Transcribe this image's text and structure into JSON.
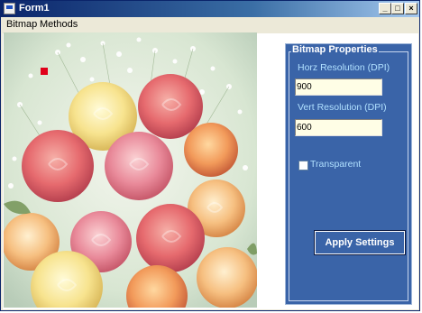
{
  "window": {
    "title": "Form1",
    "icon": "form-icon"
  },
  "title_buttons": {
    "minimize": "_",
    "maximize": "□",
    "close": "×"
  },
  "menu": {
    "items": [
      {
        "label": "Bitmap"
      },
      {
        "label": "Methods"
      }
    ]
  },
  "picture": {
    "description_icon": "roses-bouquet-image"
  },
  "properties": {
    "group_title": "Bitmap Properties",
    "horz_label": "Horz Resolution (DPI)",
    "horz_value": "900",
    "vert_label": "Vert Resolution (DPI)",
    "vert_value": "600",
    "transparent_label": "Transparent",
    "transparent_checked": false,
    "apply_label": "Apply Settings"
  },
  "colors": {
    "panel": "#3a64a8",
    "label": "#b0e0ff",
    "title_gradient_start": "#0a246a",
    "marker": "#e0001a"
  }
}
